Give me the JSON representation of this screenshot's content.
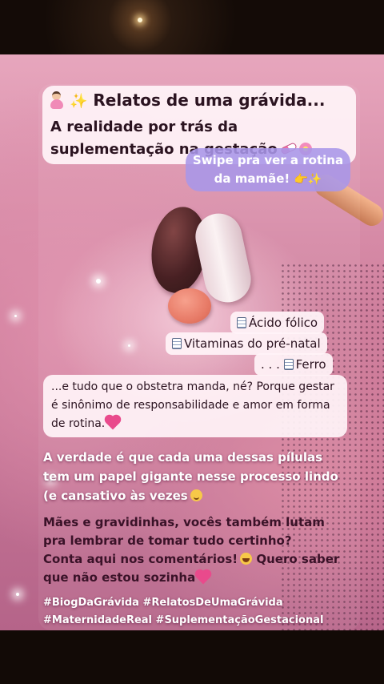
{
  "header": {
    "title": "Relatos de uma grávida...",
    "subtitle": "A realidade por trás da suplementação na gestação",
    "icons": [
      "pregnant-woman-icon",
      "sparkles-icon",
      "pill-icon",
      "flower-icon"
    ]
  },
  "swipe_hint": {
    "line1": "Swipe pra ver a rotina",
    "line2": "da mamãe!",
    "icons": [
      "pointing-hand-icon",
      "sparkles-icon"
    ]
  },
  "supplements": [
    {
      "label": "Ácido fólico",
      "icon": "document-icon"
    },
    {
      "label": "Vitaminas do pré-natal",
      "icon": "document-icon"
    },
    {
      "label": "Ferro",
      "prefix": ". . .",
      "icon": "document-icon"
    }
  ],
  "note": {
    "text": "...e tudo que o obstetra manda, né? Porque gestar é sinônimo de responsabilidade e amor em forma de rotina.",
    "icon": "heart-icon"
  },
  "paragraph1": "A verdade é que cada uma dessas pílulas tem um papel gigante nesse processo lindo (e cansativo às vezes",
  "paragraph2": {
    "line1": "Mães e gravidinhas, vocês também lutam pra lembrar de tomar tudo certinho?",
    "line2": "Conta aqui nos comentários!",
    "line3": "Quero saber que não estou sozinha"
  },
  "hashtags": {
    "line1": [
      "#BiogDaGrávida",
      "#RelatosDeUmaGrávida"
    ],
    "line2": [
      "#MaternidadeReal",
      "#SuplementaçãoGestacional"
    ]
  },
  "colors": {
    "bubble": "#fff3f8",
    "swipe_bubble": "#a896e8",
    "text_dark": "#2b1320",
    "heart": "#e94a8c",
    "background_pink": "#d9849f"
  }
}
